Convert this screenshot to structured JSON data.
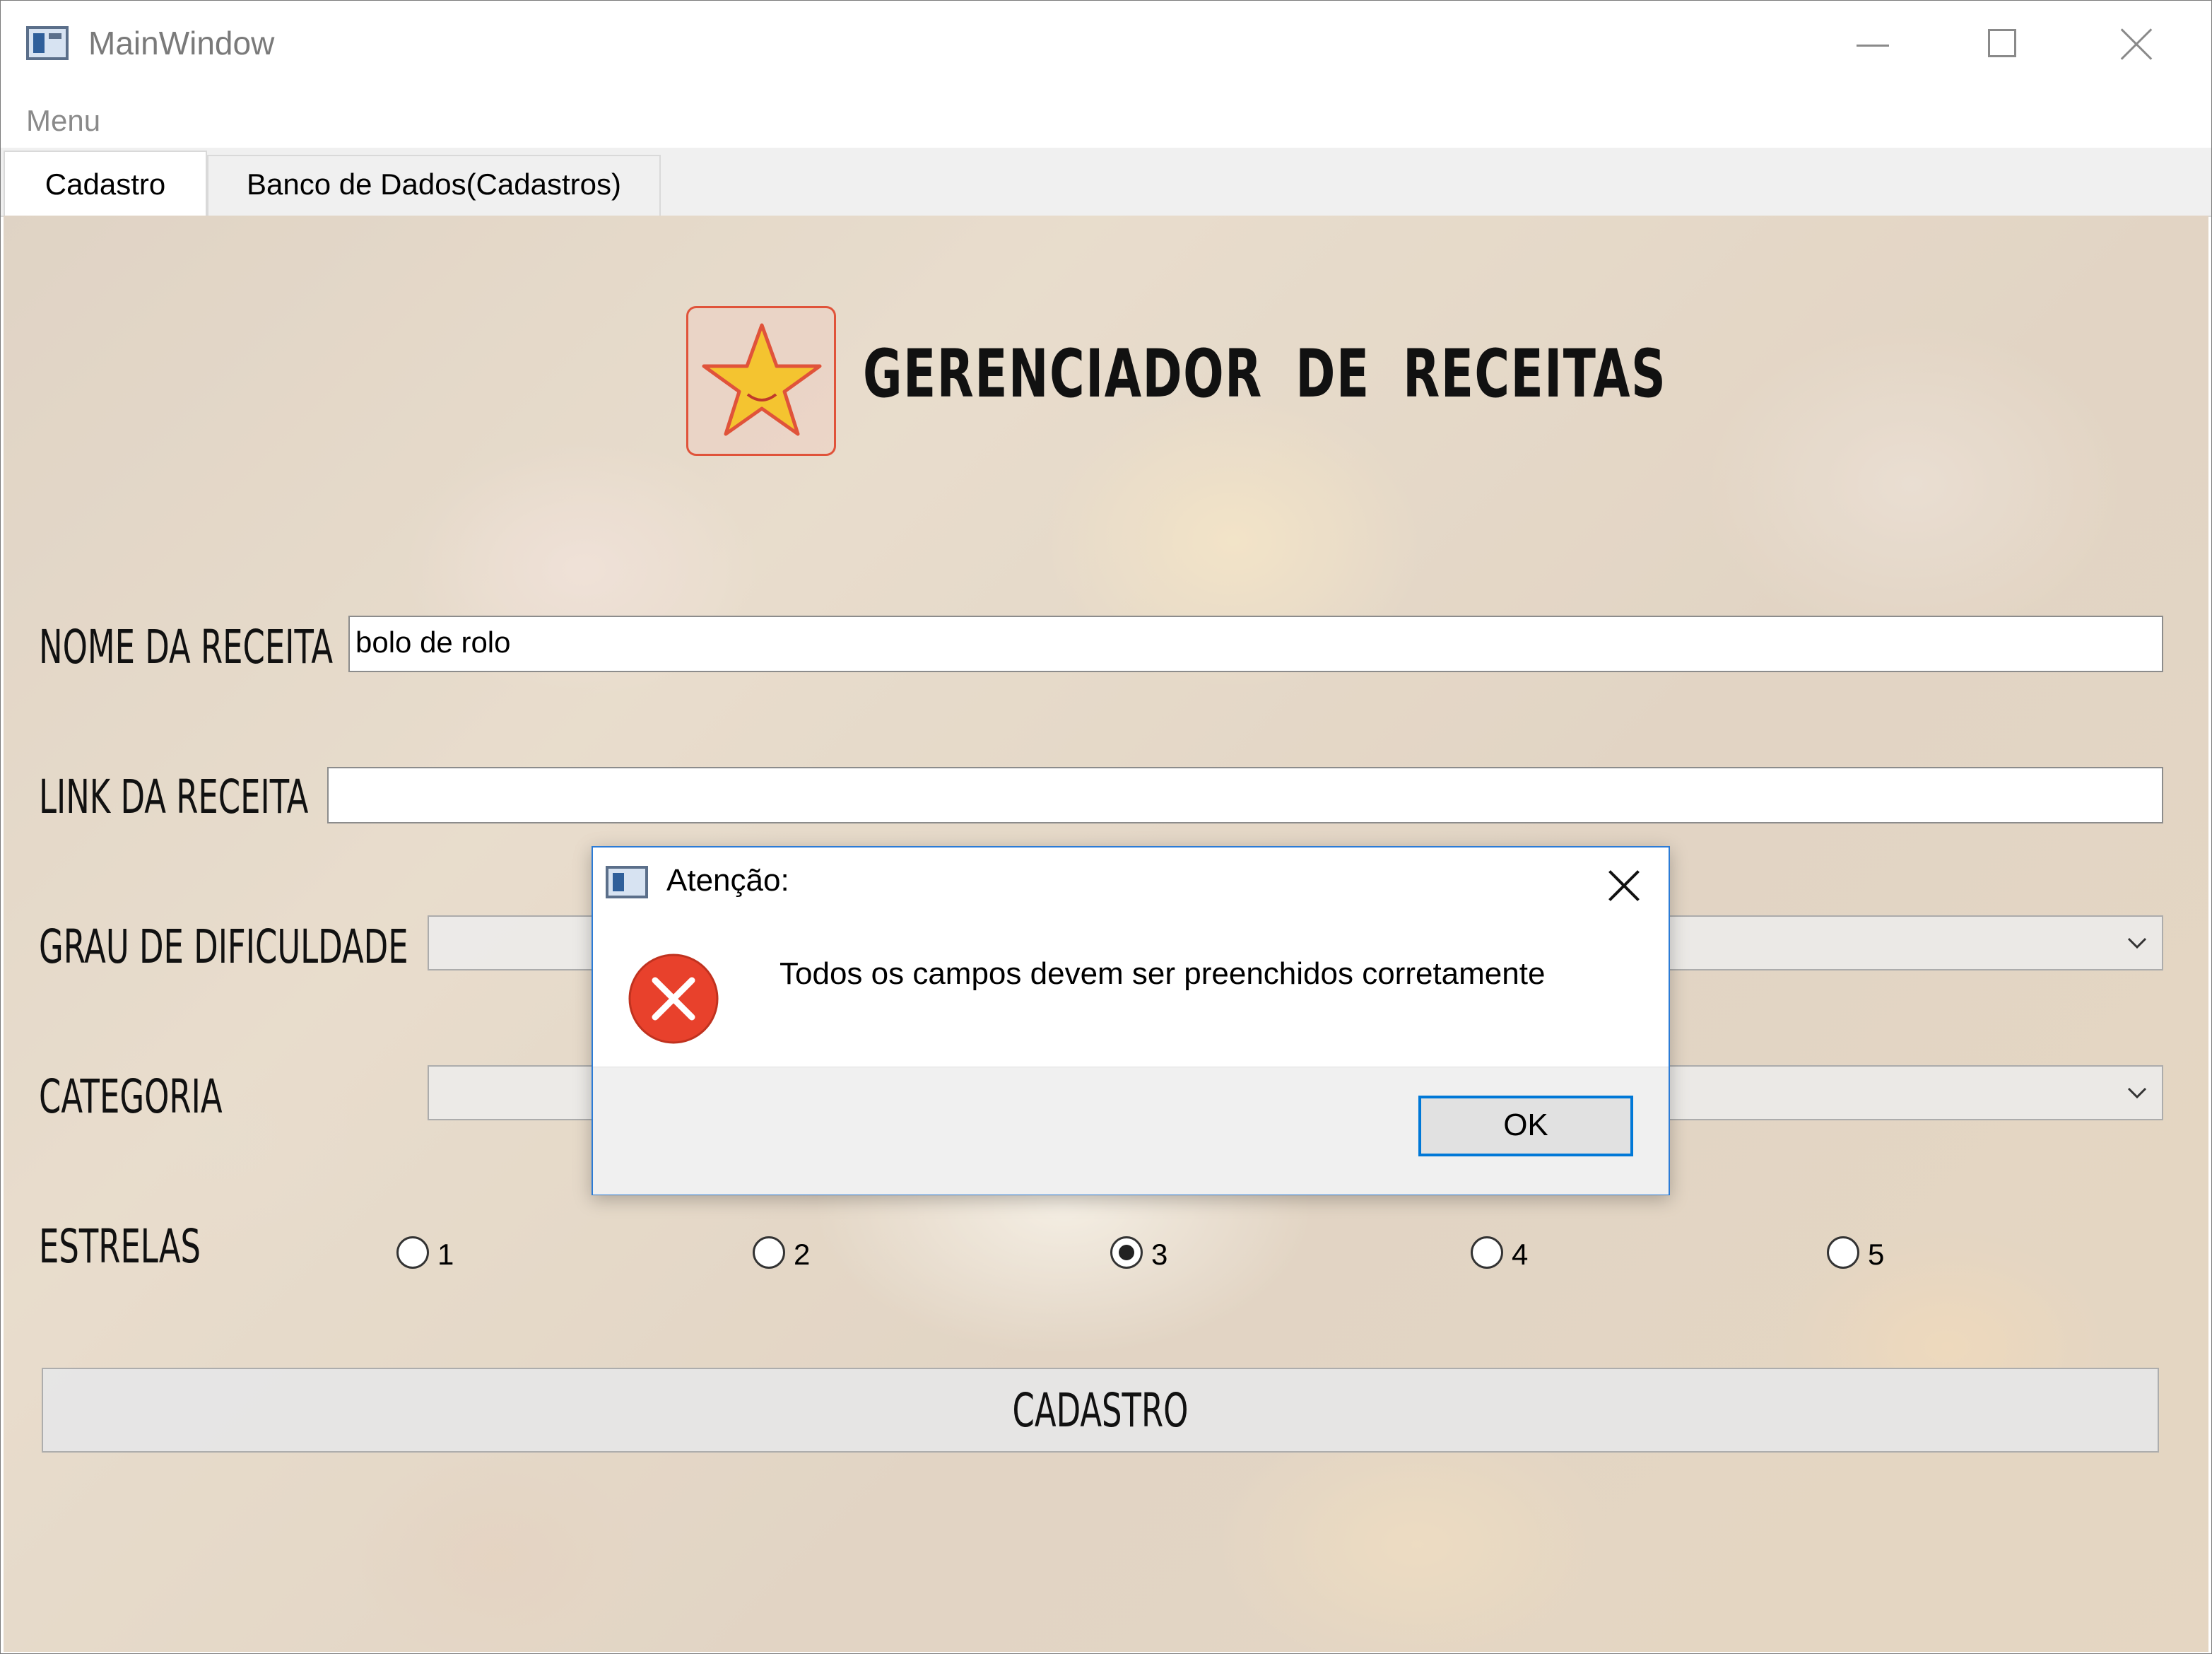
{
  "window": {
    "title": "MainWindow"
  },
  "menubar": {
    "menu_label": "Menu"
  },
  "tabs": [
    {
      "label": "Cadastro",
      "active": true
    },
    {
      "label": "Banco de Dados(Cadastros)",
      "active": false
    }
  ],
  "form": {
    "app_title": "GERENCIADOR DE RECEITAS",
    "recipe_name_label": "NOME DA RECEITA",
    "recipe_name_value": "bolo de rolo",
    "recipe_link_label": "LINK DA RECEITA",
    "recipe_link_value": "",
    "difficulty_label": "GRAU DE DIFICULDADE",
    "category_label": "CATEGORIA",
    "stars_label": "ESTRELAS",
    "star_options": [
      "1",
      "2",
      "3",
      "4",
      "5"
    ],
    "selected_star": "3",
    "submit_label": "CADASTRO"
  },
  "dialog": {
    "title": "Atenção:",
    "message": "Todos os campos devem ser preenchidos corretamente",
    "ok_label": "OK",
    "icon": "error-icon"
  },
  "colors": {
    "dialog_border": "#2b7bd6",
    "ok_focus": "#0078d7",
    "error_red": "#e8412c",
    "logo_star": "#f4c430",
    "logo_border": "#e0533a"
  }
}
